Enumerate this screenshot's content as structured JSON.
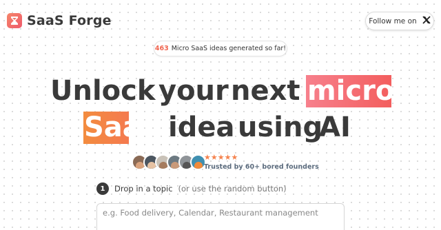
{
  "header": {
    "brand": "SaaS Forge",
    "logo_icon": "hourglass-icon",
    "follow_label": "Follow me on",
    "follow_icon": "x-logo-icon"
  },
  "counter": {
    "count": "463",
    "text": "Micro SaaS ideas generated so far!"
  },
  "headline": {
    "line1_prefix_words": [
      "Unlock",
      "your",
      "next"
    ],
    "highlight_1": "micro",
    "highlight_2": "Saa",
    "line2_suffix_words": [
      "idea",
      "using",
      "AI"
    ]
  },
  "social_proof": {
    "stars": "★★★★★",
    "rating": 5,
    "trusted_text": "Trusted by 60+ bored founders",
    "avatar_count": 6
  },
  "form": {
    "step_number": "1",
    "step_label": "Drop in a topic",
    "step_hint": "(or use the random button)",
    "topic_placeholder": "e.g. Food delivery, Calendar, Restaurant management",
    "topic_value": ""
  },
  "colors": {
    "accent": "#f0654f",
    "highlight_1": "#f4707a",
    "highlight_2": "#f3833f",
    "text": "#3a3a3a"
  }
}
